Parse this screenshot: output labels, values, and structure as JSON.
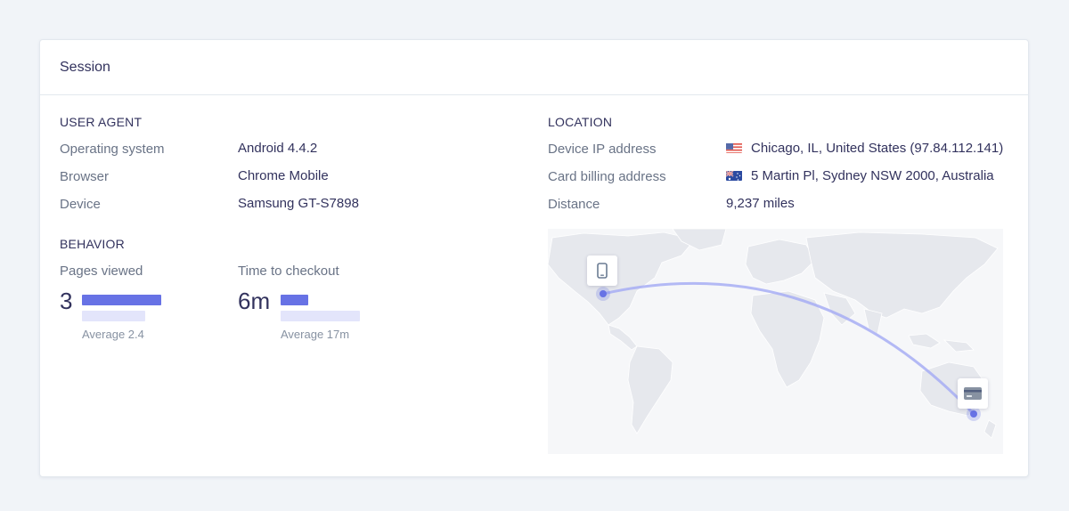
{
  "card": {
    "title": "Session"
  },
  "user_agent": {
    "title": "USER AGENT",
    "rows": [
      {
        "label": "Operating system",
        "value": "Android 4.4.2"
      },
      {
        "label": "Browser",
        "value": "Chrome Mobile"
      },
      {
        "label": "Device",
        "value": "Samsung GT-S7898"
      }
    ]
  },
  "behavior": {
    "title": "BEHAVIOR",
    "pages": {
      "label": "Pages viewed",
      "value": "3",
      "average": "Average 2.4",
      "bar_fraction": 1.0,
      "avg_fraction": 0.8
    },
    "checkout": {
      "label": "Time to checkout",
      "value": "6m",
      "average": "Average 17m",
      "bar_fraction": 0.35,
      "avg_fraction": 1.0
    }
  },
  "location": {
    "title": "LOCATION",
    "rows": [
      {
        "label": "Device IP address",
        "value": "Chicago, IL, United States (97.84.112.141)",
        "flag": "us-flag"
      },
      {
        "label": "Card billing address",
        "value": "5 Martin Pl, Sydney NSW 2000, Australia",
        "flag": "au-flag"
      },
      {
        "label": "Distance",
        "value": "9,237 miles"
      }
    ]
  },
  "map": {
    "device_pin_icon": "phone-icon",
    "card_pin_icon": "credit-card-icon",
    "route_color": "#a3a9f4",
    "pin_color": "#6772e5"
  }
}
